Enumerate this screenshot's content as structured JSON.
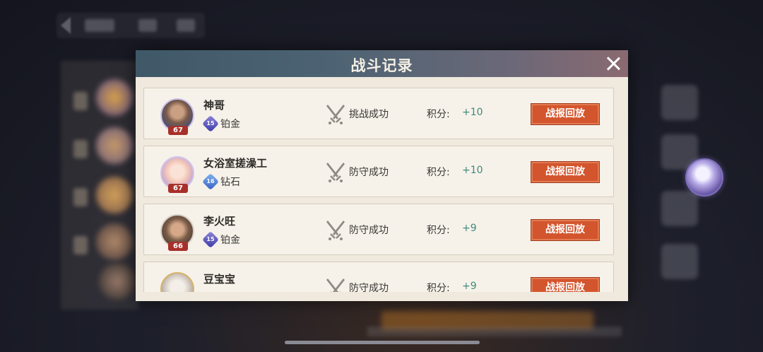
{
  "dialog": {
    "title": "战斗记录",
    "records": [
      {
        "name": "神哥",
        "level": "67",
        "tier_number": "15",
        "tier": "铂金",
        "result": "挑战成功",
        "score_label": "积分:",
        "score": "+10",
        "button": "战报回放",
        "avatar_colors": [
          "#7a5a4a",
          "#3f4f7a"
        ]
      },
      {
        "name": "女浴室搓澡工",
        "level": "67",
        "tier_number": "16",
        "tier": "钻石",
        "result": "防守成功",
        "score_label": "积分:",
        "score": "+10",
        "button": "战报回放",
        "avatar_colors": [
          "#f4c9b9",
          "#b596d6"
        ]
      },
      {
        "name": "李火旺",
        "level": "66",
        "tier_number": "15",
        "tier": "铂金",
        "result": "防守成功",
        "score_label": "积分:",
        "score": "+9",
        "button": "战报回放",
        "avatar_colors": [
          "#7b5d48",
          "#4a3a32"
        ]
      },
      {
        "name": "豆宝宝",
        "level": "",
        "tier_number": "",
        "tier": "",
        "result": "防守成功",
        "score_label": "积分:",
        "score": "+9",
        "button": "战报回放",
        "avatar_colors": [
          "#e8e3dc",
          "#9b8f86"
        ]
      }
    ]
  },
  "colors": {
    "accent_button": "#d3552d",
    "score_positive": "#3f8a7c",
    "level_badge": "#a8302a"
  },
  "icons": [
    "close-icon",
    "crossed-swords-icon",
    "tier-badge-icon"
  ]
}
